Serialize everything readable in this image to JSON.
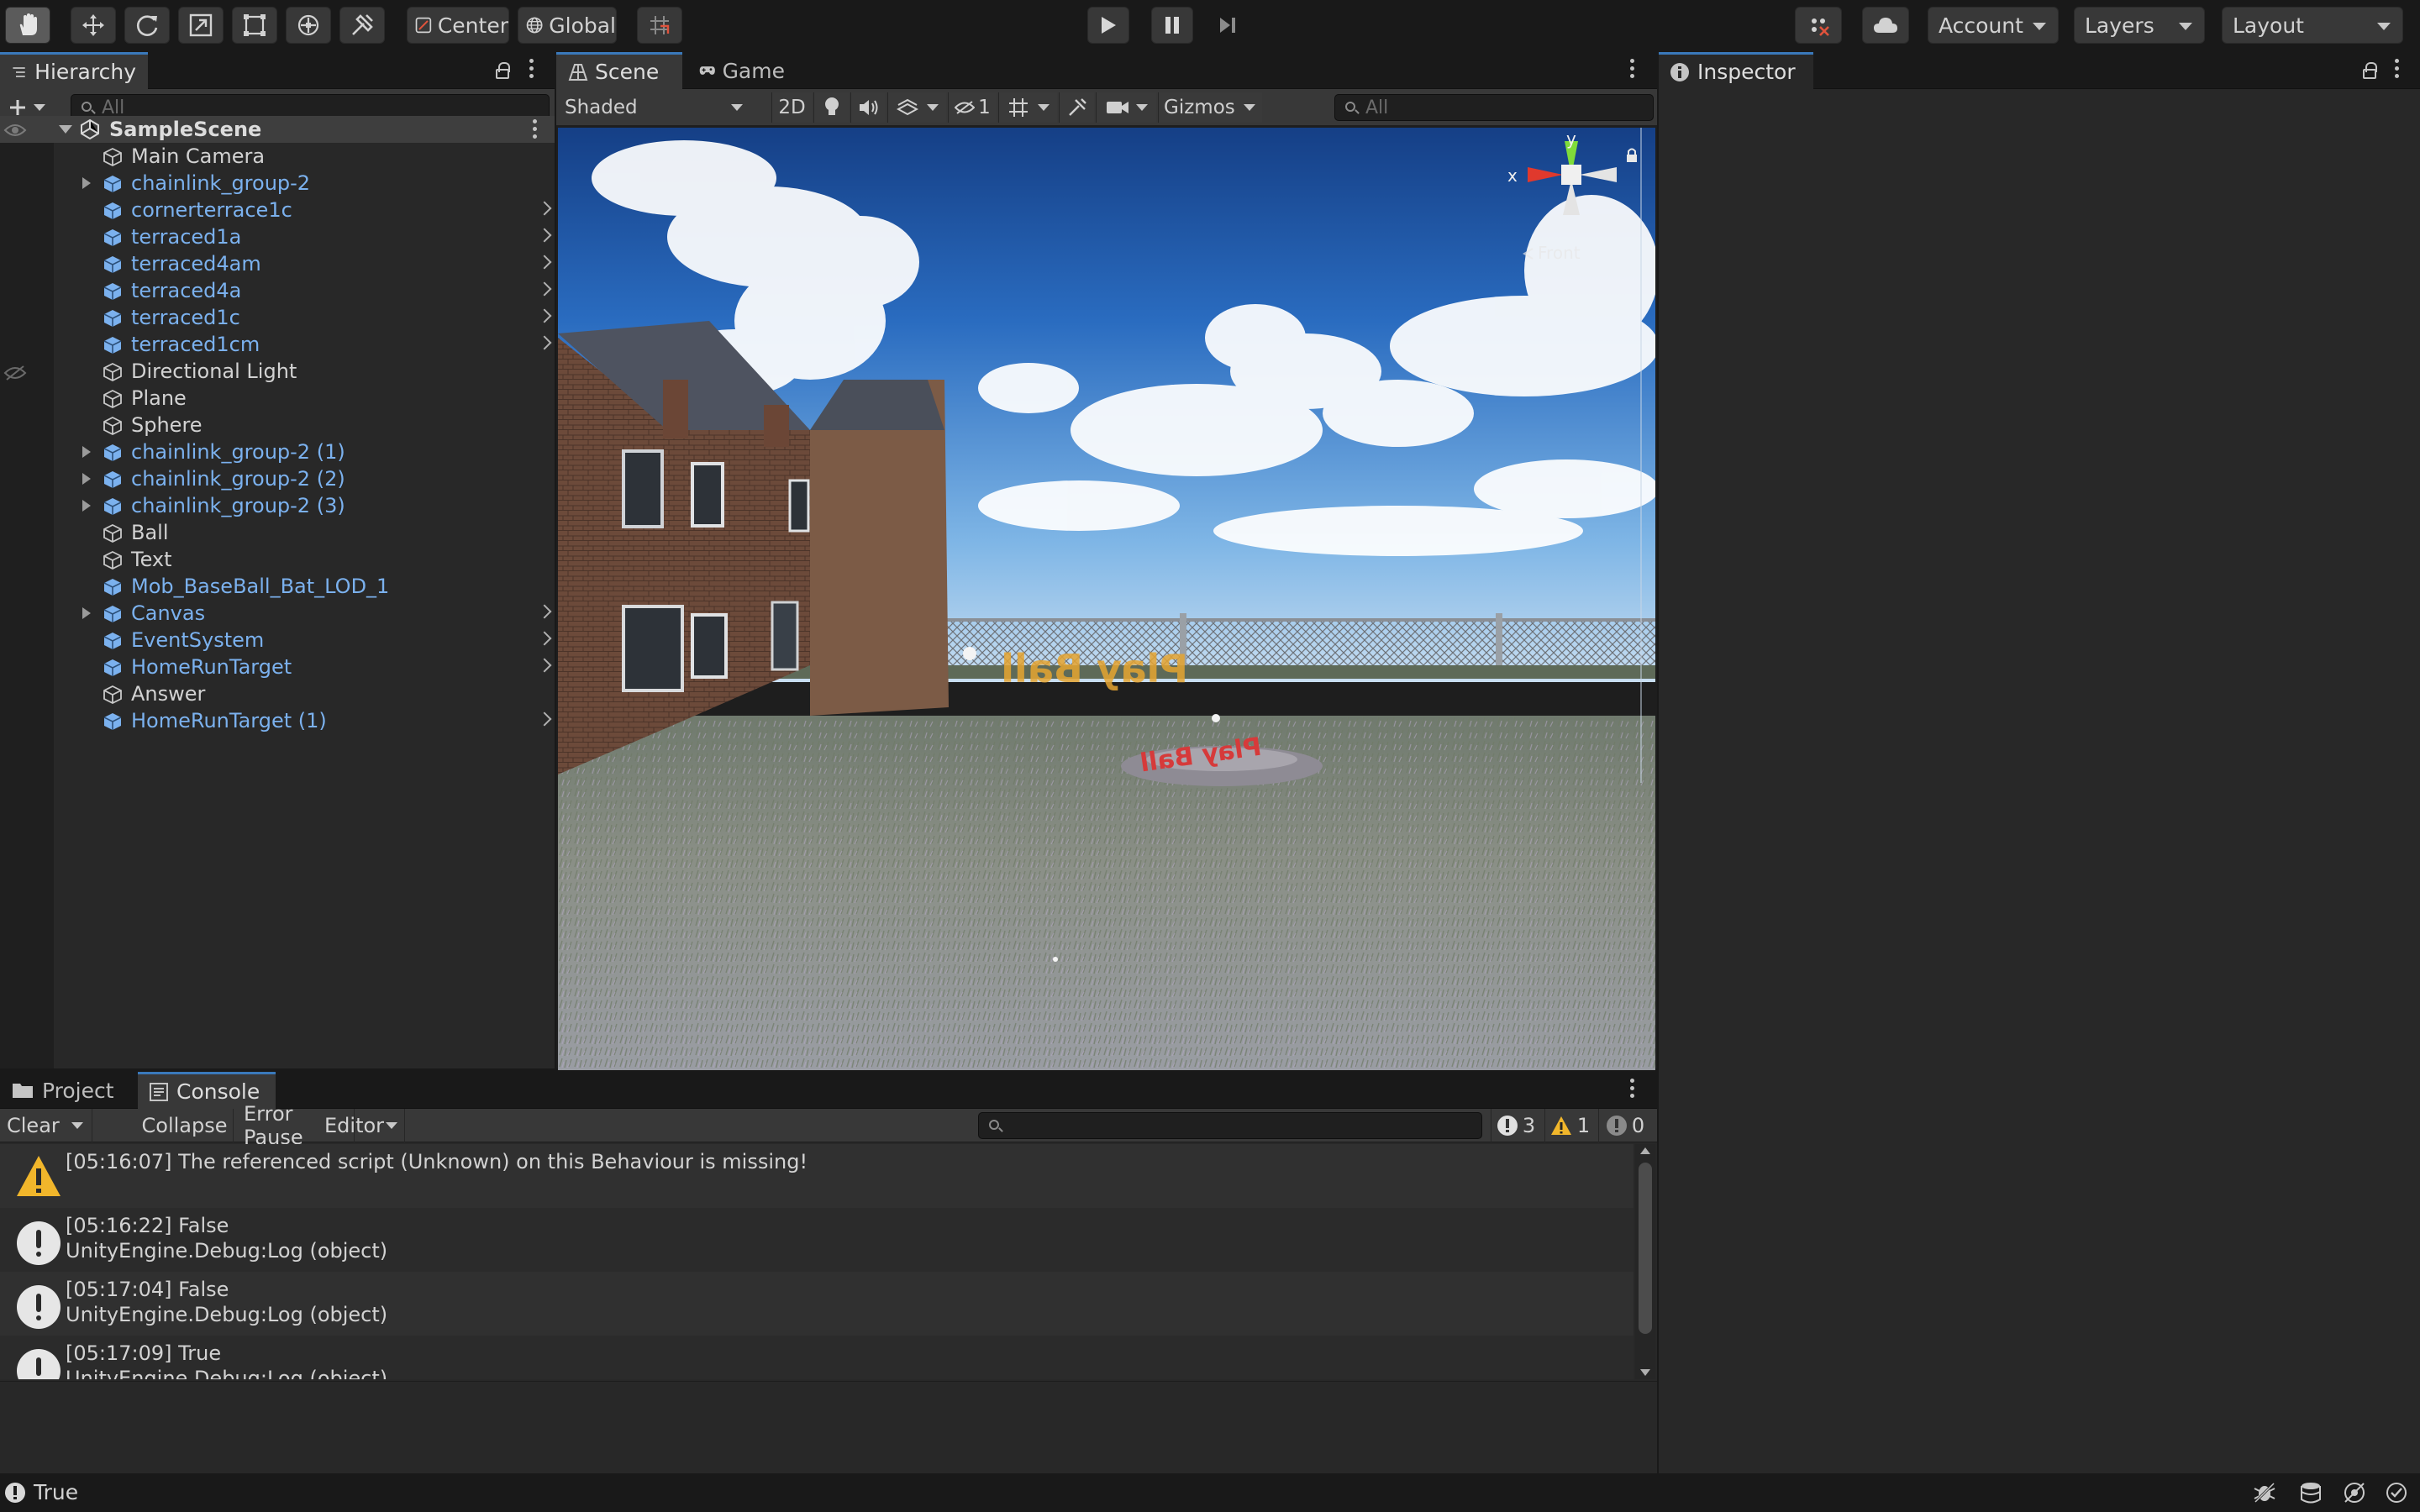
{
  "toolbar": {
    "pivot_label": "Center",
    "space_label": "Global",
    "account_label": "Account",
    "layers_label": "Layers",
    "layout_label": "Layout",
    "tools": [
      "hand-tool-icon",
      "move-tool-icon",
      "rotate-tool-icon",
      "scale-tool-icon",
      "rect-tool-icon",
      "transform-tool-icon",
      "custom-tool-icon"
    ]
  },
  "hierarchy": {
    "tab_label": "Hierarchy",
    "search_placeholder": "All",
    "scene_name": "SampleScene",
    "items": [
      {
        "label": "Main Camera",
        "kind": "plain",
        "fold": false,
        "arrow": false
      },
      {
        "label": "chainlink_group-2",
        "kind": "prefab",
        "fold": true,
        "arrow": false
      },
      {
        "label": "cornerterrace1c",
        "kind": "prefab",
        "fold": false,
        "arrow": true
      },
      {
        "label": "terraced1a",
        "kind": "prefab",
        "fold": false,
        "arrow": true
      },
      {
        "label": "terraced4am",
        "kind": "prefab",
        "fold": false,
        "arrow": true
      },
      {
        "label": "terraced4a",
        "kind": "prefab",
        "fold": false,
        "arrow": true
      },
      {
        "label": "terraced1c",
        "kind": "prefab",
        "fold": false,
        "arrow": true
      },
      {
        "label": "terraced1cm",
        "kind": "prefab",
        "fold": false,
        "arrow": true
      },
      {
        "label": "Directional Light",
        "kind": "plain",
        "fold": false,
        "arrow": false
      },
      {
        "label": "Plane",
        "kind": "plain",
        "fold": false,
        "arrow": false
      },
      {
        "label": "Sphere",
        "kind": "plain",
        "fold": false,
        "arrow": false
      },
      {
        "label": "chainlink_group-2 (1)",
        "kind": "prefab",
        "fold": true,
        "arrow": false
      },
      {
        "label": "chainlink_group-2 (2)",
        "kind": "prefab",
        "fold": true,
        "arrow": false
      },
      {
        "label": "chainlink_group-2 (3)",
        "kind": "prefab",
        "fold": true,
        "arrow": false
      },
      {
        "label": "Ball",
        "kind": "plain",
        "fold": false,
        "arrow": false
      },
      {
        "label": "Text",
        "kind": "plain",
        "fold": false,
        "arrow": false
      },
      {
        "label": "Mob_BaseBall_Bat_LOD_1",
        "kind": "prefab",
        "fold": false,
        "arrow": false
      },
      {
        "label": "Canvas",
        "kind": "prefab",
        "fold": true,
        "arrow": true
      },
      {
        "label": "EventSystem",
        "kind": "prefab",
        "fold": false,
        "arrow": true
      },
      {
        "label": "HomeRunTarget",
        "kind": "prefab",
        "fold": false,
        "arrow": true
      },
      {
        "label": "Answer",
        "kind": "plain",
        "fold": false,
        "arrow": false
      },
      {
        "label": "HomeRunTarget (1)",
        "kind": "prefab",
        "fold": false,
        "arrow": true
      }
    ]
  },
  "scene": {
    "tab_scene": "Scene",
    "tab_game": "Game",
    "shading_mode": "Shaded",
    "mode_2d": "2D",
    "hidden_count": "1",
    "gizmos_label": "Gizmos",
    "search_placeholder": "All",
    "gizmo_axis_y": "y",
    "gizmo_axis_x": "x",
    "gizmo_view": "Front",
    "world_text_1": "Play Ball",
    "world_text_2": "Play Ball"
  },
  "inspector": {
    "tab_label": "Inspector"
  },
  "console": {
    "tab_project": "Project",
    "tab_console": "Console",
    "clear_label": "Clear",
    "collapse_label": "Collapse",
    "error_pause_label": "Error Pause",
    "editor_label": "Editor",
    "count_info": "3",
    "count_warning": "1",
    "count_error": "0",
    "logs": [
      {
        "type": "warning",
        "line1": "[05:16:07] The referenced script (Unknown) on this Behaviour is missing!",
        "line2": ""
      },
      {
        "type": "info",
        "line1": "[05:16:22] False",
        "line2": "UnityEngine.Debug:Log (object)"
      },
      {
        "type": "info",
        "line1": "[05:17:04] False",
        "line2": "UnityEngine.Debug:Log (object)"
      },
      {
        "type": "info",
        "line1": "[05:17:09] True",
        "line2": "UnityEngine.Debug:Log (object)"
      }
    ]
  },
  "status": {
    "message": "True"
  }
}
